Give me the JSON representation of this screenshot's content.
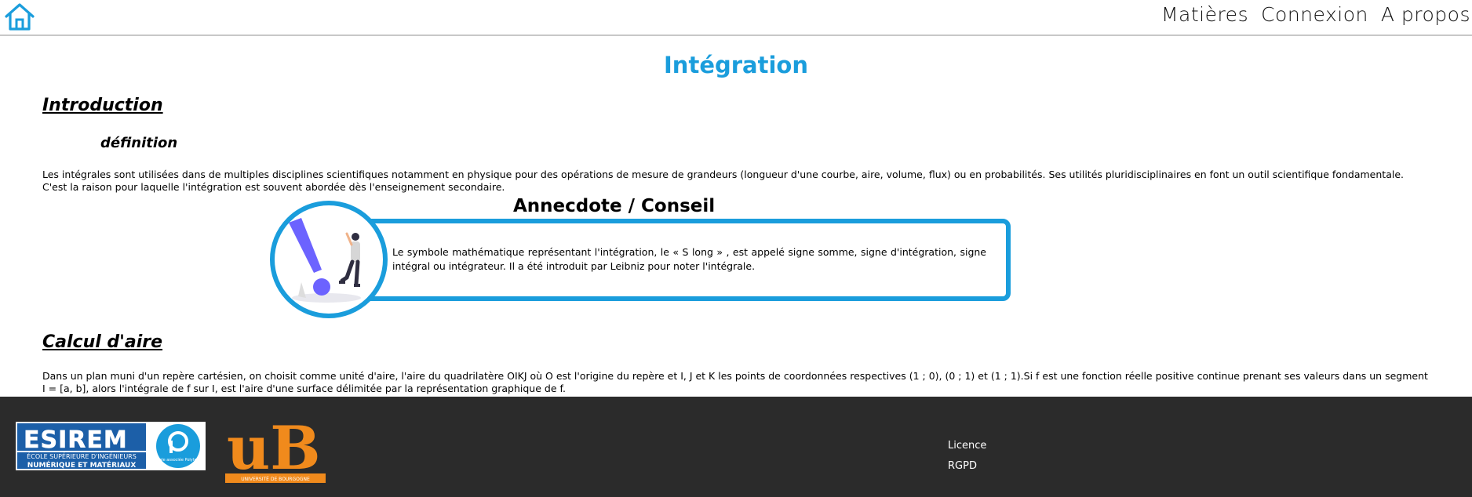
{
  "header": {
    "home_icon": "home-icon",
    "nav": [
      "Matières",
      "Connexion",
      "A propos"
    ]
  },
  "page": {
    "title": "Intégration",
    "intro_heading": "Introduction",
    "definition_heading": "définition",
    "intro_text": "Les intégrales sont utilisées dans de multiples disciplines scientifiques notamment en physique pour des opérations de mesure de grandeurs (longueur d'une courbe, aire, volume, flux) ou en probabilités. Ses utilités pluridisciplinaires en font un outil scientifique fondamentale. C'est la raison pour laquelle l'intégration est souvent abordée dès l'enseignement secondaire.",
    "anecdote_title": "Annecdote / Conseil",
    "anecdote_text": "Le symbole mathématique représentant l'intégration, le « S long » , est appelé signe somme, signe d'intégration, signe intégral ou intégrateur. Il a été introduit par Leibniz pour noter l'intégrale.",
    "area_heading": "Calcul d'aire",
    "area_text": "Dans un plan muni d'un repère cartésien, on choisit comme unité d'aire, l'aire du quadrilatère OIKJ où O est l'origine du repère et I, J et K les points de coordonnées respectives (1 ; 0), (0 ; 1) et (1 ; 1).Si f est une fonction réelle positive continue prenant ses valeurs dans un segment I = [a, b], alors l'intégrale de f sur I, est l'aire d'une surface délimitée par la représentation graphique de f."
  },
  "footer": {
    "esirem_logo": {
      "name": "ESIREM",
      "line1": "ÉCOLE SUPÉRIEURE D'INGÉNIEURS",
      "line2": "NUMÉRIQUE ET MATÉRIAUX",
      "badge": "École associée Polytech"
    },
    "ub_logo": {
      "name": "uB",
      "caption": "UNIVERSITÉ DE BOURGOGNE"
    },
    "links": [
      "Licence",
      "RGPD"
    ]
  },
  "colors": {
    "accent": "#1a9ddc",
    "footer_bg": "#2b2b2b",
    "ub_orange": "#f08a1c",
    "illustration_purple": "#6c63ff"
  }
}
